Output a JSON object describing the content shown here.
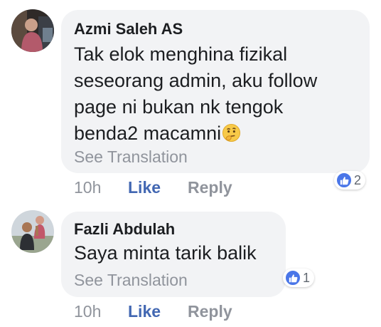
{
  "comments": [
    {
      "author": "Azmi Saleh AS",
      "body_lines": [
        "Tak elok menghina fizikal",
        "seseorang admin, aku follow",
        "page ni bukan nk tengok",
        "benda2 macamni"
      ],
      "emoji": "thinking-face",
      "see_translation": "See Translation",
      "reaction_icon": "like-icon",
      "reaction_count": "2",
      "time": "10h",
      "like_label": "Like",
      "reply_label": "Reply"
    },
    {
      "author": "Fazli Abdulah",
      "body_lines": [
        "Saya minta tarik balik"
      ],
      "see_translation": "See Translation",
      "reaction_icon": "like-icon",
      "reaction_count": "1",
      "time": "10h",
      "like_label": "Like",
      "reply_label": "Reply"
    }
  ],
  "colors": {
    "bubble": "#f2f3f5",
    "author": "#1c1e21",
    "muted": "#90949c",
    "link": "#4267b2",
    "like_badge": "#4a76e8"
  }
}
